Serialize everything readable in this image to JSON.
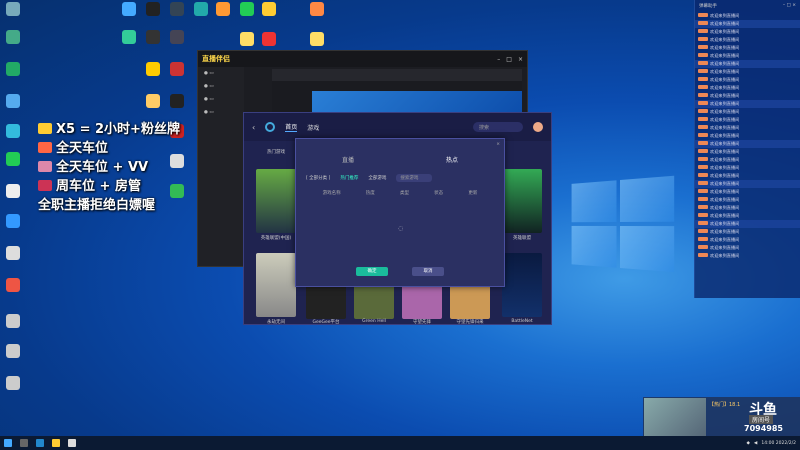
{
  "desktop": {
    "icons_col1": [
      "",
      "",
      "",
      "",
      "",
      "",
      "",
      "",
      "",
      "",
      "",
      "",
      ""
    ],
    "icons_top": [
      "",
      "",
      "",
      "",
      "",
      "",
      "",
      "",
      "",
      "",
      ""
    ]
  },
  "overlay": {
    "lines": [
      "X5 = 2小时+粉丝牌",
      "全天车位",
      "全天车位 + VV",
      "周车位 + 房管",
      "全职主播拒绝白嫖喔"
    ]
  },
  "back_window": {
    "logo": "直播伴侣",
    "tabs": [
      "",
      "",
      ""
    ]
  },
  "launcher": {
    "tabs": [
      "首页",
      "游戏"
    ],
    "search_placeholder": "搜索",
    "games": [
      {
        "name": "热门游戏"
      },
      {
        "name": "英雄联盟(中国)"
      },
      {
        "name": "永劫无间"
      },
      {
        "name": "GeeGee平台"
      },
      {
        "name": "Green Hell"
      },
      {
        "name": "守望先锋"
      },
      {
        "name": "守望先锋归来"
      },
      {
        "name": "BattleNet"
      },
      {
        "name": "英雄联盟"
      }
    ]
  },
  "dialog": {
    "title": "",
    "tabs": [
      "直播",
      "热点"
    ],
    "filter_left": "[ 全部分类 ]",
    "filter_mid": "全部",
    "filter_sel": "热门推荐",
    "filter_alt": "全部游戏",
    "search_placeholder": "搜索游戏",
    "columns": [
      "游戏名称",
      "热度",
      "类型",
      "状态",
      "更新"
    ],
    "confirm": "确定",
    "cancel": "取消",
    "close": "×"
  },
  "chat": {
    "header": "弹幕助手",
    "messages": [
      "欢迎来到直播间",
      "欢迎来到直播间",
      "欢迎来到直播间",
      "欢迎来到直播间",
      "欢迎来到直播间",
      "欢迎来到直播间",
      "欢迎来到直播间",
      "欢迎来到直播间",
      "欢迎来到直播间",
      "欢迎来到直播间",
      "欢迎来到直播间",
      "欢迎来到直播间",
      "欢迎来到直播间",
      "欢迎来到直播间",
      "欢迎来到直播间",
      "欢迎来到直播间",
      "欢迎来到直播间",
      "欢迎来到直播间",
      "欢迎来到直播间",
      "欢迎来到直播间",
      "欢迎来到直播间",
      "欢迎来到直播间",
      "欢迎来到直播间",
      "欢迎来到直播间",
      "欢迎来到直播间",
      "欢迎来到直播间",
      "欢迎来到直播间",
      "欢迎来到直播间",
      "欢迎来到直播间",
      "欢迎来到直播间",
      "欢迎来到直播间"
    ]
  },
  "stream_card": {
    "info": "【热门】18.1",
    "logo": "斗鱼",
    "room_label": "房间号",
    "room_number": "7094985"
  },
  "taskbar": {
    "time": "14:00",
    "date": "2022/2/2"
  }
}
